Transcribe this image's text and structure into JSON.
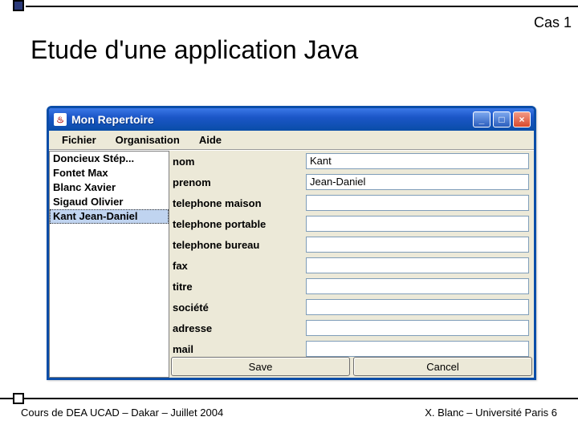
{
  "slide": {
    "cas_label": "Cas 1",
    "title": "Etude d'une application Java",
    "footer_left": "Cours de DEA UCAD – Dakar – Juillet 2004",
    "footer_right": "X. Blanc – Université Paris 6"
  },
  "window": {
    "title": "Mon Repertoire",
    "icon_glyph": "♨"
  },
  "menu": {
    "items": [
      "Fichier",
      "Organisation",
      "Aide"
    ]
  },
  "list": {
    "items": [
      "Doncieux Stép...",
      "Fontet Max",
      "Blanc Xavier",
      "Sigaud Olivier",
      "Kant Jean-Daniel"
    ],
    "selected_index": 4
  },
  "form": {
    "fields": [
      {
        "label": "nom",
        "value": "Kant"
      },
      {
        "label": "prenom",
        "value": "Jean-Daniel"
      },
      {
        "label": "telephone maison",
        "value": ""
      },
      {
        "label": "telephone portable",
        "value": ""
      },
      {
        "label": "telephone bureau",
        "value": ""
      },
      {
        "label": "fax",
        "value": ""
      },
      {
        "label": "titre",
        "value": ""
      },
      {
        "label": "société",
        "value": ""
      },
      {
        "label": "adresse",
        "value": ""
      },
      {
        "label": "mail",
        "value": ""
      }
    ],
    "buttons": {
      "save": "Save",
      "cancel": "Cancel"
    }
  }
}
